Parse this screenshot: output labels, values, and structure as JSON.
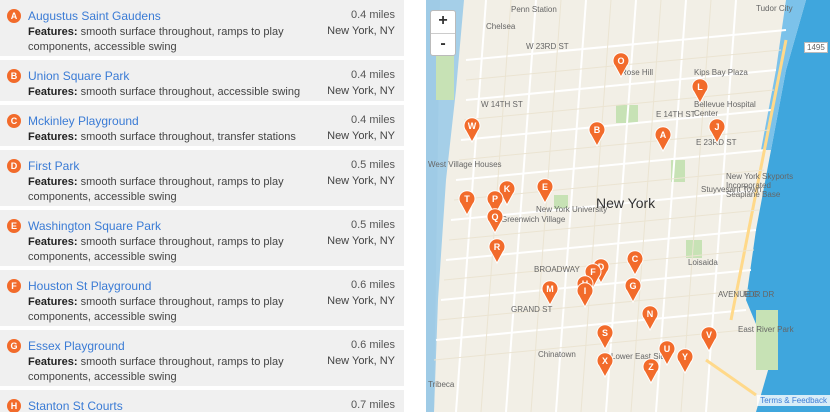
{
  "results": [
    {
      "letter": "A",
      "name": "Augustus Saint Gaudens",
      "distance": "0.4 miles",
      "features_label": "Features:",
      "features": "smooth surface throughout, ramps to play components, accessible swing",
      "city": "New York, NY"
    },
    {
      "letter": "B",
      "name": "Union Square Park",
      "distance": "0.4 miles",
      "features_label": "Features:",
      "features": "smooth surface throughout, accessible swing",
      "city": "New York, NY"
    },
    {
      "letter": "C",
      "name": "Mckinley Playground",
      "distance": "0.4 miles",
      "features_label": "Features:",
      "features": "smooth surface throughout, transfer stations",
      "city": "New York, NY"
    },
    {
      "letter": "D",
      "name": "First Park",
      "distance": "0.5 miles",
      "features_label": "Features:",
      "features": "smooth surface throughout, ramps to play components, accessible swing",
      "city": "New York, NY"
    },
    {
      "letter": "E",
      "name": "Washington Square Park",
      "distance": "0.5 miles",
      "features_label": "Features:",
      "features": "smooth surface throughout, ramps to play components, accessible swing",
      "city": "New York, NY"
    },
    {
      "letter": "F",
      "name": "Houston St Playground",
      "distance": "0.6 miles",
      "features_label": "Features:",
      "features": "smooth surface throughout, ramps to play components, accessible swing",
      "city": "New York, NY"
    },
    {
      "letter": "G",
      "name": "Essex Playground",
      "distance": "0.6 miles",
      "features_label": "Features:",
      "features": "smooth surface throughout, ramps to play components, accessible swing",
      "city": "New York, NY"
    },
    {
      "letter": "H",
      "name": "Stanton St Courts",
      "distance": "0.7 miles",
      "features_label": "",
      "features": "",
      "city": ""
    }
  ],
  "map": {
    "zoom_in": "+",
    "zoom_out": "-",
    "city_label": "New York",
    "attribution": "Terms & Feedback",
    "marker_color": "#f26b2b",
    "labels": [
      "Penn Station",
      "Chelsea",
      "Rose Hill",
      "Kips Bay Plaza",
      "Bellevue Hospital Center",
      "Tudor City",
      "West Village Houses",
      "Greenwich Village",
      "New York University",
      "Stuyvesant Town",
      "New York Skyports Incorporated Seaplane Base",
      "Loisaida",
      "Chinatown",
      "Lower East Side",
      "East River Park",
      "Tribeca",
      "E 23RD ST",
      "W 23RD ST",
      "W 14TH ST",
      "E 14TH ST",
      "BROADWAY",
      "GRAND ST",
      "AVENUE C",
      "FDR DR",
      "1495"
    ],
    "markers": [
      "A",
      "B",
      "C",
      "D",
      "E",
      "F",
      "G",
      "H",
      "I",
      "J",
      "K",
      "L",
      "M",
      "N",
      "O",
      "P",
      "Q",
      "R",
      "S",
      "T",
      "U",
      "V",
      "W",
      "X",
      "Y",
      "Z"
    ]
  }
}
